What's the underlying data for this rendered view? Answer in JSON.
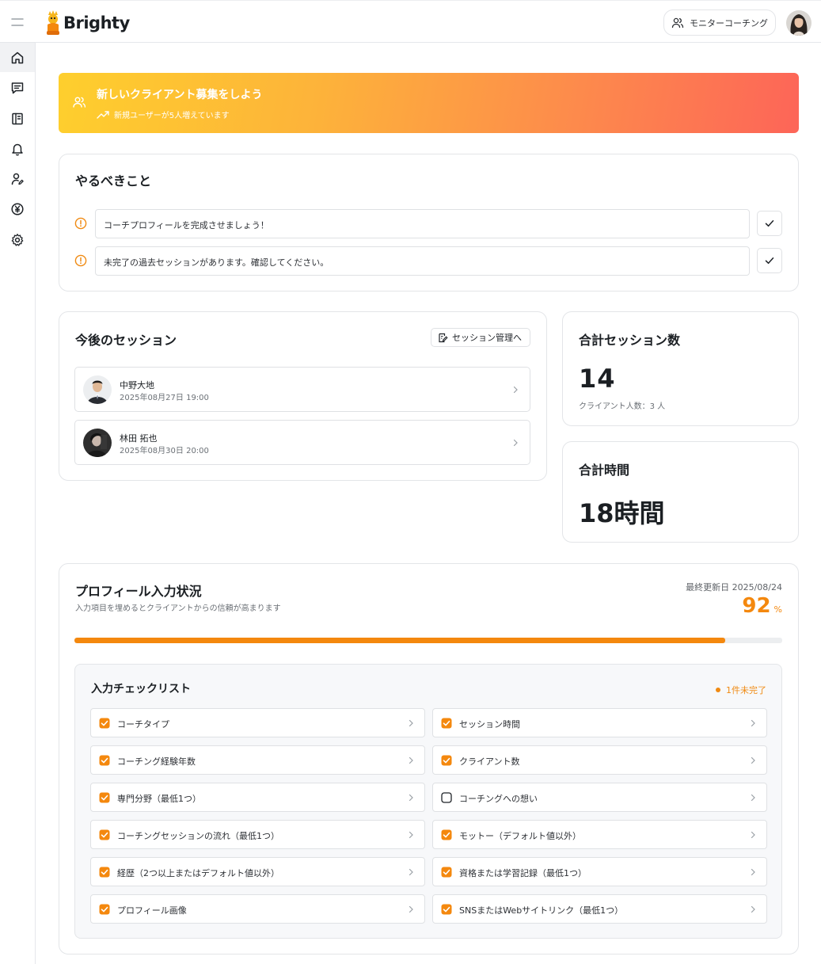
{
  "app": {
    "name": "Brighty",
    "monitor_label": "モニターコーチング"
  },
  "sidebar": {
    "items": [
      {
        "icon": "home-icon",
        "active": true
      },
      {
        "icon": "chat-icon",
        "active": false
      },
      {
        "icon": "book-icon",
        "active": false
      },
      {
        "icon": "bell-icon",
        "active": false
      },
      {
        "icon": "user-edit-icon",
        "active": false
      },
      {
        "icon": "yen-icon",
        "active": false
      },
      {
        "icon": "gear-icon",
        "active": false
      }
    ]
  },
  "banner": {
    "title": "新しいクライアント募集をしよう",
    "subtitle": "新規ユーザーが5人増えています"
  },
  "todo": {
    "title": "やるべきこと",
    "items": [
      "コーチプロフィールを完成させましょう！",
      "未完了の過去セッションがあります。確認してください。"
    ]
  },
  "sessions": {
    "title": "今後のセッション",
    "manage_label": "セッション管理へ",
    "items": [
      {
        "name": "中野大地",
        "datetime": "2025年08月27日 19:00"
      },
      {
        "name": "林田 拓也",
        "datetime": "2025年08月30日 20:00"
      }
    ]
  },
  "stats": {
    "sessions_title": "合計セッション数",
    "sessions_value": "14",
    "clients_text": "クライアント人数：3 人",
    "hours_title": "合計時間",
    "hours_value": "18時間"
  },
  "profile": {
    "title": "プロフィール入力状況",
    "subtitle": "入力項目を埋めるとクライアントからの信頼が高まります",
    "updated": "最終更新日 2025/08/24",
    "percent": "92",
    "percent_unit": "%",
    "progress": 0.92,
    "checklist_title": "入力チェックリスト",
    "incomplete_label": "1件未完了",
    "items_left": [
      {
        "label": "コーチタイプ",
        "done": true
      },
      {
        "label": "コーチング経験年数",
        "done": true
      },
      {
        "label": "専門分野（最低1つ）",
        "done": true
      },
      {
        "label": "コーチングセッションの流れ（最低1つ）",
        "done": true
      },
      {
        "label": "経歴（2つ以上またはデフォルト値以外）",
        "done": true
      },
      {
        "label": "プロフィール画像",
        "done": true
      }
    ],
    "items_right": [
      {
        "label": "セッション時間",
        "done": true
      },
      {
        "label": "クライアント数",
        "done": true
      },
      {
        "label": "コーチングへの想い",
        "done": false
      },
      {
        "label": "モットー（デフォルト値以外）",
        "done": true
      },
      {
        "label": "資格または学習記録（最低1つ）",
        "done": true
      },
      {
        "label": "SNSまたはWebサイトリンク（最低1つ）",
        "done": true
      }
    ]
  },
  "colors": {
    "accent": "#f4880e",
    "warning": "#f08a12"
  }
}
